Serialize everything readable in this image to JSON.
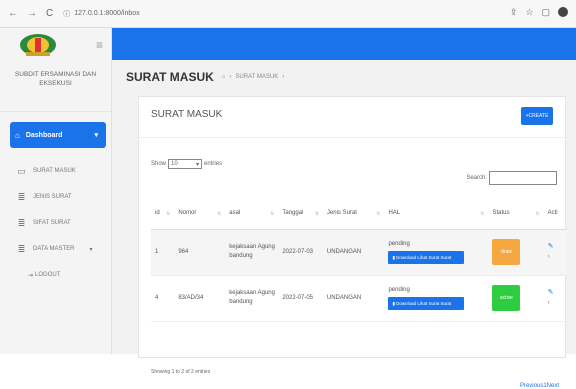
{
  "browser": {
    "url": "127.0.0.1:8000/inbox",
    "back": "←",
    "forward": "→",
    "reload": "C",
    "info": "ⓘ"
  },
  "sidebar": {
    "org_name": "SUBDIT ERSAMINASI DAN EKSEKUSI",
    "active_item": "Dashboard",
    "items": [
      {
        "label": "SURAT MASUK",
        "icon": "inbox-icon"
      },
      {
        "label": "JENIS SURAT",
        "icon": "list-icon"
      },
      {
        "label": "SIFAT SURAT",
        "icon": "list-icon"
      },
      {
        "label": "DATA MASTER",
        "icon": "database-icon"
      },
      {
        "label": "LOGOUT",
        "icon": "logout-icon"
      }
    ]
  },
  "page": {
    "title": "SURAT MASUK",
    "breadcrumb": "SURAT MASUK",
    "card_title": "SURAT MASUK",
    "create_label": "+CREATE",
    "show_label": "Show",
    "entries_value": "10",
    "entries_label": "entries",
    "search_label": "Search:"
  },
  "table": {
    "headers": [
      "id",
      "Nomor",
      "asal",
      "Tanggal",
      "Jenis Surat",
      "HAL",
      "Status",
      "Acti"
    ],
    "rows": [
      {
        "id": "1",
        "nomor": "964",
        "asal": "kejaksaan Agung bandung",
        "tanggal": "2022-07-03",
        "jenis": "UNDANGAN",
        "hal": "pending",
        "download": "Download Lihat Surat Surat",
        "status": "draw",
        "status_color": "#f5a742"
      },
      {
        "id": "4",
        "nomor": "83/AD/34",
        "asal": "kejaksaan Agung bandung",
        "tanggal": "2022-07-05",
        "jenis": "UNDANGAN",
        "hal": "pending",
        "download": "Download Lihat Surat Surat",
        "status": "active",
        "status_color": "#2ecc40"
      }
    ]
  },
  "footer": {
    "info": "Showing 1 to 2 of 2 entries",
    "pager": "Previous1Next"
  },
  "colors": {
    "primary": "#1a73e8"
  }
}
